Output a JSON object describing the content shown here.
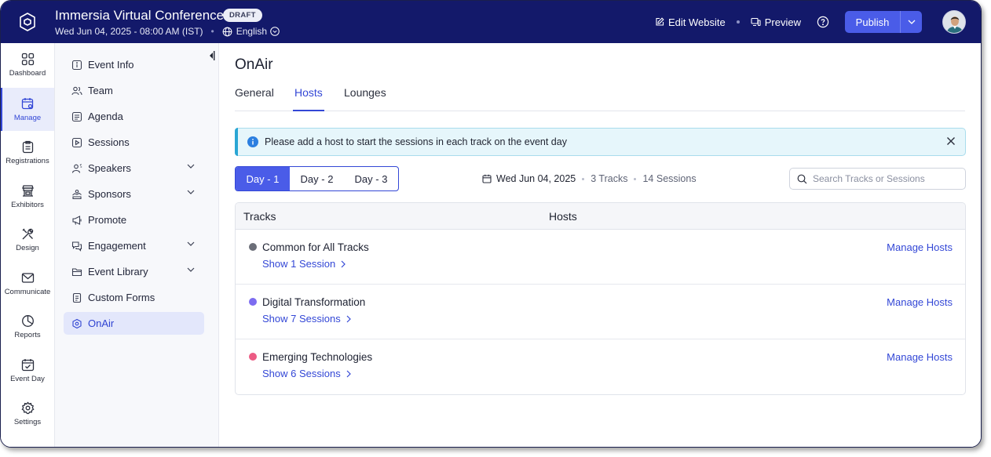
{
  "header": {
    "event_title": "Immersia Virtual Conference",
    "status_badge": "DRAFT",
    "datetime": "Wed Jun 04, 2025 - 08:00 AM (IST)",
    "language": "English",
    "edit_website_label": "Edit Website",
    "preview_label": "Preview",
    "publish_label": "Publish"
  },
  "rail": {
    "items": [
      {
        "label": "Dashboard",
        "icon": "grid-icon"
      },
      {
        "label": "Manage",
        "icon": "calendar-gear-icon",
        "active": true
      },
      {
        "label": "Registrations",
        "icon": "clipboard-icon"
      },
      {
        "label": "Exhibitors",
        "icon": "booth-icon"
      },
      {
        "label": "Design",
        "icon": "tools-icon"
      },
      {
        "label": "Communicate",
        "icon": "envelope-icon"
      },
      {
        "label": "Reports",
        "icon": "pie-chart-icon"
      },
      {
        "label": "Event Day",
        "icon": "calendar-check-icon"
      },
      {
        "label": "Settings",
        "icon": "gear-icon"
      }
    ]
  },
  "nav": {
    "items": [
      {
        "label": "Event Info"
      },
      {
        "label": "Team"
      },
      {
        "label": "Agenda"
      },
      {
        "label": "Sessions"
      },
      {
        "label": "Speakers"
      },
      {
        "label": "Sponsors"
      },
      {
        "label": "Promote"
      },
      {
        "label": "Engagement"
      },
      {
        "label": "Event Library"
      },
      {
        "label": "Custom Forms"
      },
      {
        "label": "OnAir",
        "active": true
      }
    ]
  },
  "main": {
    "page_title": "OnAir",
    "tabs": [
      {
        "label": "General"
      },
      {
        "label": "Hosts",
        "active": true
      },
      {
        "label": "Lounges"
      }
    ],
    "info_message": "Please add a host to start the sessions in each track on the event day",
    "days": [
      {
        "label": "Day - 1",
        "active": true
      },
      {
        "label": "Day - 2"
      },
      {
        "label": "Day - 3"
      }
    ],
    "date": "Wed Jun 04, 2025",
    "tracks_count": "3 Tracks",
    "sessions_count": "14 Sessions",
    "search_placeholder": "Search Tracks or Sessions",
    "table": {
      "col_tracks": "Tracks",
      "col_hosts": "Hosts",
      "rows": [
        {
          "name": "Common for All Tracks",
          "sessions": "Show 1 Session",
          "action": "Manage Hosts",
          "color": "#6b6e78"
        },
        {
          "name": "Digital Transformation",
          "sessions": "Show 7 Sessions",
          "action": "Manage Hosts",
          "color": "#7c6cf0"
        },
        {
          "name": "Emerging Technologies",
          "sessions": "Show 6 Sessions",
          "action": "Manage Hosts",
          "color": "#ec5b84"
        }
      ]
    }
  }
}
